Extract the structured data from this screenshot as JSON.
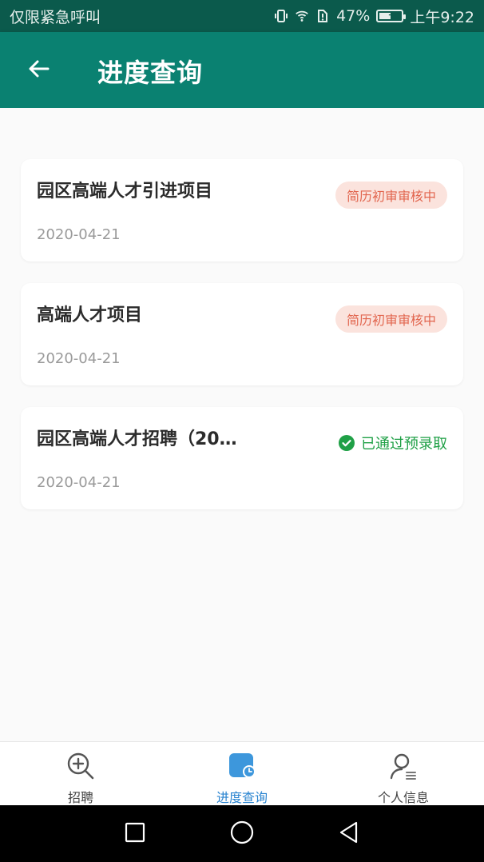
{
  "status_bar": {
    "left_text": "仅限紧急呼叫",
    "battery_percent": "47%",
    "time": "上午9:22"
  },
  "header": {
    "title": "进度查询"
  },
  "cards": [
    {
      "title": "园区高端人才引进项目",
      "status": "简历初审审核中",
      "date": "2020-04-21"
    },
    {
      "title": "高端人才项目",
      "status": "简历初审审核中",
      "date": "2020-04-21"
    },
    {
      "title": "园区高端人才招聘（20…",
      "status": "已通过预录取",
      "date": "2020-04-21"
    }
  ],
  "bottom_nav": [
    {
      "label": "招聘",
      "icon": "search-plus-icon"
    },
    {
      "label": "进度查询",
      "icon": "progress-icon"
    },
    {
      "label": "个人信息",
      "icon": "user-icon"
    }
  ],
  "colors": {
    "header_bg": "#0a8171",
    "status_bg": "#0b5a4c",
    "pending_text": "#e2664f",
    "pending_bg": "#fbe3dd",
    "approved": "#1fa046",
    "active_nav": "#2a84d0"
  }
}
